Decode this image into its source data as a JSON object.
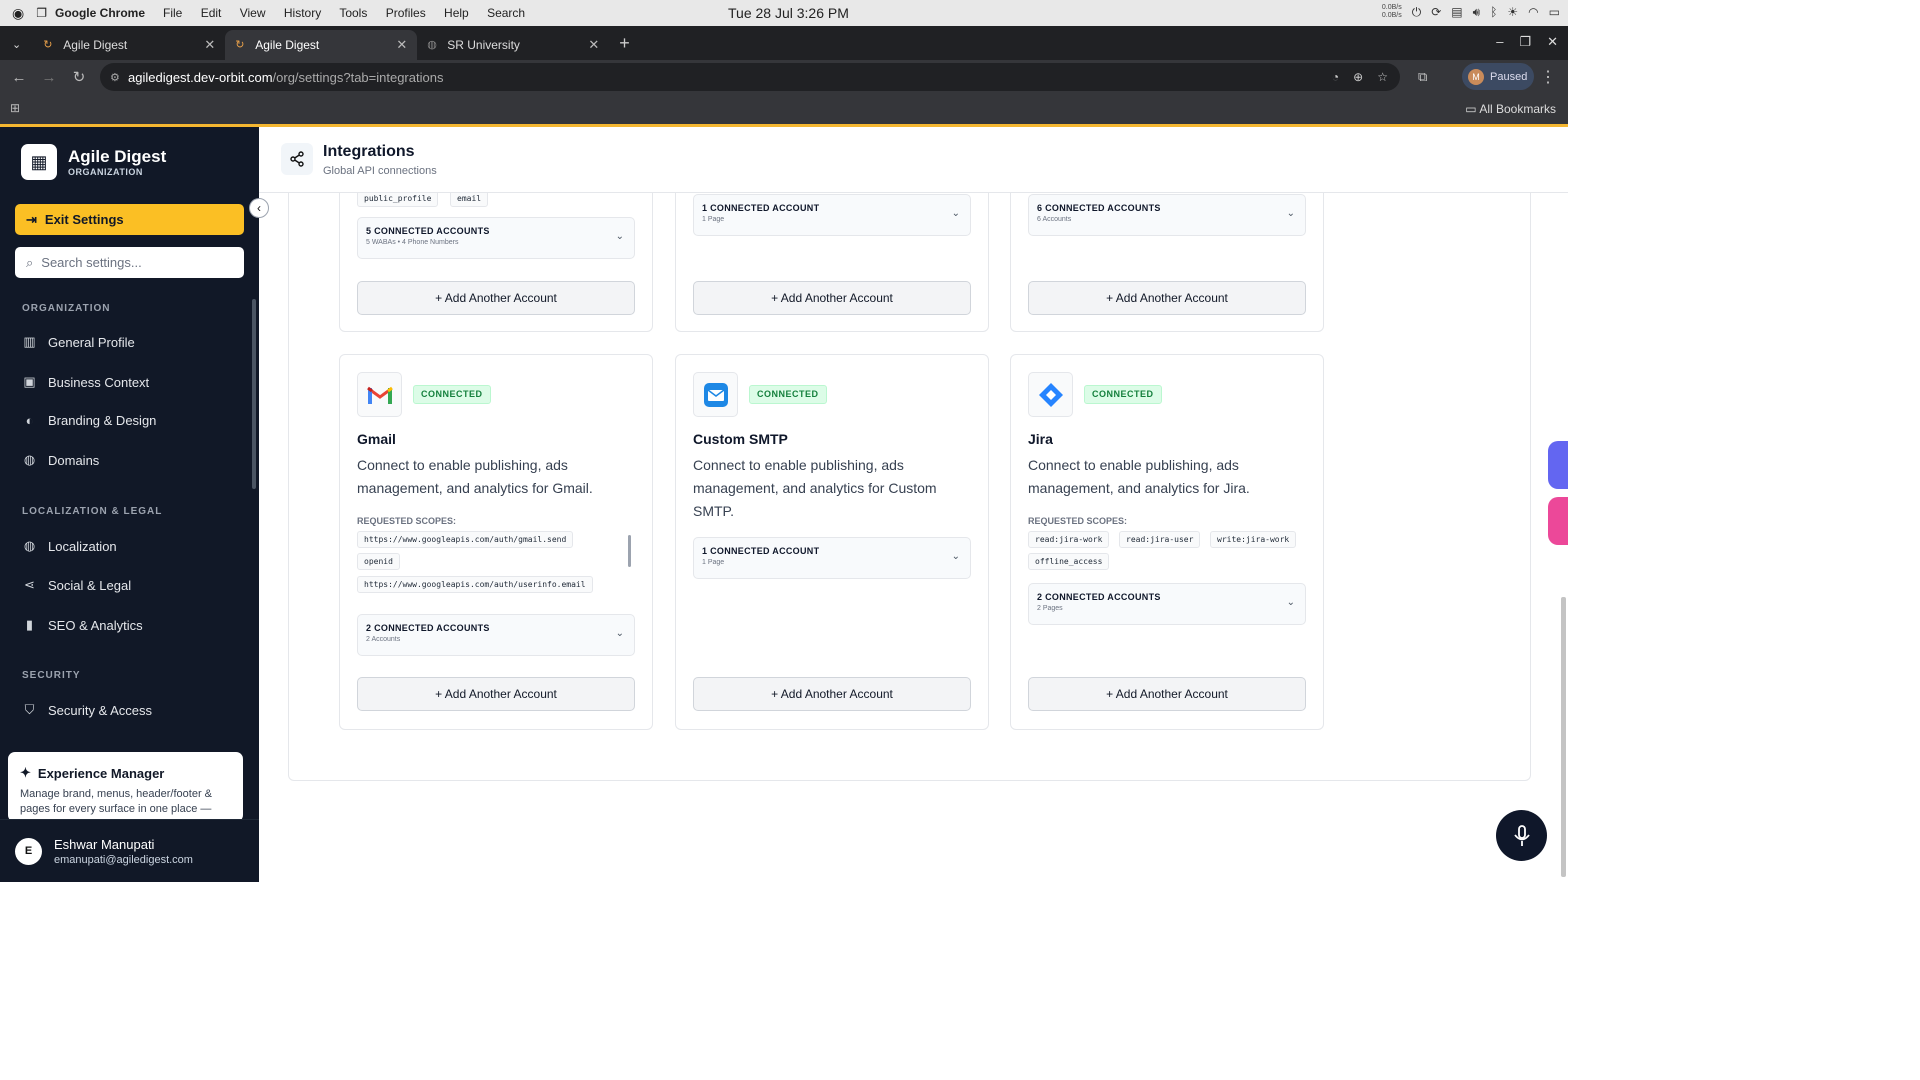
{
  "system": {
    "app_name": "Google Chrome",
    "menu": [
      "File",
      "Edit",
      "View",
      "History",
      "Tools",
      "Profiles",
      "Help",
      "Search"
    ],
    "clock": "Tue 28 Jul  3:26 PM",
    "net_up": "0.0B/s",
    "net_down": "0.0B/s"
  },
  "browser": {
    "tabs": [
      {
        "title": "Agile Digest"
      },
      {
        "title": "Agile Digest"
      },
      {
        "title": "SR University"
      }
    ],
    "url_host": "agiledigest.dev-orbit.com",
    "url_path": "/org/settings?tab=integrations",
    "profile_initial": "M",
    "profile_status": "Paused",
    "bookmarks_label": "All Bookmarks"
  },
  "sidebar": {
    "org_name": "Agile Digest",
    "org_type": "ORGANIZATION",
    "exit_label": "Exit Settings",
    "search_placeholder": "Search settings...",
    "sections": [
      {
        "title": "ORGANIZATION",
        "items": [
          "General Profile",
          "Business Context",
          "Branding & Design",
          "Domains"
        ]
      },
      {
        "title": "LOCALIZATION & LEGAL",
        "items": [
          "Localization",
          "Social & Legal",
          "SEO & Analytics"
        ]
      },
      {
        "title": "SECURITY",
        "items": [
          "Security & Access"
        ]
      }
    ],
    "experience": {
      "title": "Experience Manager",
      "desc": "Manage brand, menus, header/footer & pages for every surface in one place — with inheritance & live URL..."
    },
    "user": {
      "initial": "E",
      "name": "Eshwar Manupati",
      "email": "emanupati@agiledigest.com"
    }
  },
  "page": {
    "title": "Integrations",
    "subtitle": "Global API connections"
  },
  "top_cards": [
    {
      "scopes": [
        "public_profile",
        "email"
      ],
      "accounts_title": "5 CONNECTED ACCOUNTS",
      "accounts_sub": "5 WABAs • 4 Phone Numbers",
      "add_label": "+ Add Another Account"
    },
    {
      "accounts_title": "1 CONNECTED ACCOUNT",
      "accounts_sub": "1 Page",
      "add_label": "+ Add Another Account"
    },
    {
      "accounts_title": "6 CONNECTED ACCOUNTS",
      "accounts_sub": "6 Accounts",
      "add_label": "+ Add Another Account"
    }
  ],
  "cards": [
    {
      "name": "Gmail",
      "status": "CONNECTED",
      "desc": "Connect to enable publishing, ads management, and analytics for Gmail.",
      "scopes_label": "REQUESTED SCOPES:",
      "scopes": [
        "https://www.googleapis.com/auth/gmail.send",
        "openid",
        "https://www.googleapis.com/auth/userinfo.email"
      ],
      "accounts_title": "2 CONNECTED ACCOUNTS",
      "accounts_sub": "2 Accounts",
      "add_label": "+ Add Another Account",
      "icon": "gmail-icon"
    },
    {
      "name": "Custom SMTP",
      "status": "CONNECTED",
      "desc": "Connect to enable publishing, ads management, and analytics for Custom SMTP.",
      "accounts_title": "1 CONNECTED ACCOUNT",
      "accounts_sub": "1 Page",
      "add_label": "+ Add Another Account",
      "icon": "mail-icon"
    },
    {
      "name": "Jira",
      "status": "CONNECTED",
      "desc": "Connect to enable publishing, ads management, and analytics for Jira.",
      "scopes_label": "REQUESTED SCOPES:",
      "scopes": [
        "read:jira-work",
        "read:jira-user",
        "write:jira-work",
        "offline_access"
      ],
      "accounts_title": "2 CONNECTED ACCOUNTS",
      "accounts_sub": "2 Pages",
      "add_label": "+ Add Another Account",
      "icon": "jira-icon"
    }
  ],
  "colors": {
    "accent": "#fbbf24",
    "sidebar": "#111827",
    "connected": "#15803d"
  }
}
